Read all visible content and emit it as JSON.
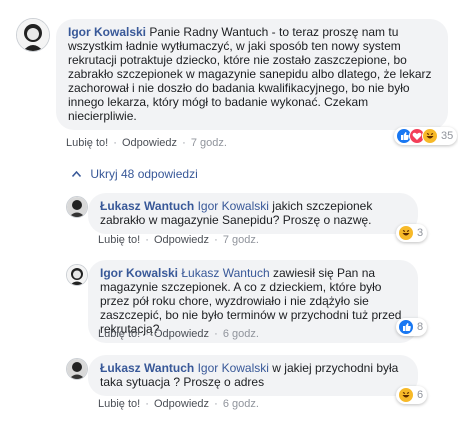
{
  "main_comment": {
    "author": "Igor Kowalski",
    "text": "Panie Radny Wantuch - to teraz proszę nam tu wszystkim ładnie wytłumaczyć, w jaki sposób ten nowy system rekrutacji potraktuje dziecko, które nie zostało zaszczepione, bo zabrakło szczepionek w magazynie sanepidu albo dlatego, że lekarz zachorował i nie doszło do badania kwalifikacyjnego, bo nie było innego lekarza, który mógł to badanie wykonać. Czekam niecierpliwie.",
    "like_label": "Lubię to!",
    "reply_label": "Odpowiedz",
    "time": "7 godz.",
    "reaction_count": "35",
    "reaction_icons": [
      "like-icon",
      "love-icon",
      "haha-icon"
    ]
  },
  "toggle_replies": {
    "label": "Ukryj 48 odpowiedzi",
    "icon": "chevron-up-icon"
  },
  "replies": [
    {
      "author": "Łukasz Wantuch",
      "mention": "Igor Kowalski",
      "text": "jakich szczepionek zabrakło w magazynie Sanepidu? Proszę o nazwę.",
      "like_label": "Lubię to!",
      "reply_label": "Odpowiedz",
      "time": "7 godz.",
      "reaction_count": "3",
      "reaction_icon": "haha-icon"
    },
    {
      "author": "Igor Kowalski",
      "mention": "Łukasz Wantuch",
      "text": "zawiesił się Pan na magazynie szczepionek. A co z dzieckiem, które było przez pół roku chore, wyzdrowiało i nie zdążyło sie zaszczepić, bo nie było terminów w przychodni tuż przed rekrutacją?",
      "like_label": "Lubię to!",
      "reply_label": "Odpowiedz",
      "time": "6 godz.",
      "reaction_count": "8",
      "reaction_icon": "like-icon"
    },
    {
      "author": "Łukasz Wantuch",
      "mention": "Igor Kowalski",
      "text": "w jakiej przychodni była taka sytuacja ? Proszę o adres",
      "like_label": "Lubię to!",
      "reply_label": "Odpowiedz",
      "time": "6 godz.",
      "reaction_count": "6",
      "reaction_icon": "haha-icon"
    }
  ],
  "separator": "·",
  "colors": {
    "link": "#385898",
    "bubble": "#f2f3f5",
    "meta": "#90949c",
    "like": "#1877f2",
    "love": "#f33e58",
    "haha": "#f7b928"
  }
}
